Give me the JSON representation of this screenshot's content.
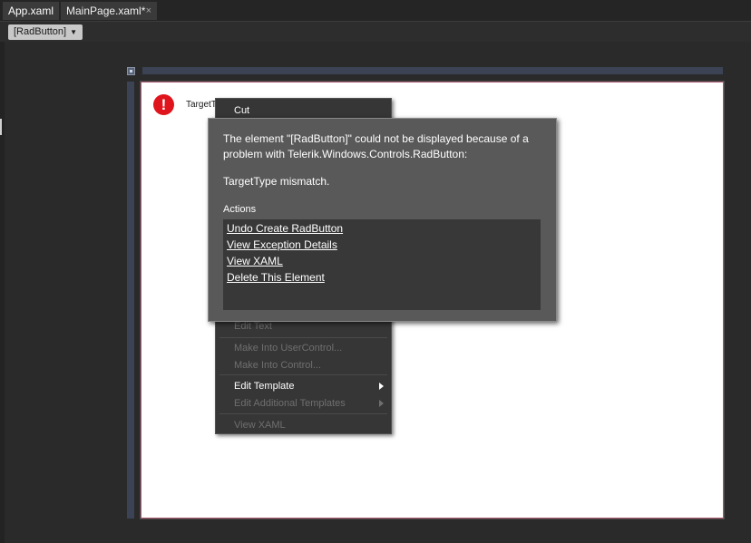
{
  "tabs": [
    {
      "label": "App.xaml"
    },
    {
      "label": "MainPage.xaml*",
      "close": "×"
    }
  ],
  "breadcrumb": {
    "label": "[RadButton]"
  },
  "canvas": {
    "target_text": "TargetT"
  },
  "context_menu": {
    "items": [
      {
        "label": "Cut",
        "enabled": true
      },
      {
        "label": "Edit Text",
        "enabled": false
      },
      {
        "label": "Make Into UserControl...",
        "enabled": false
      },
      {
        "label": "Make Into Control...",
        "enabled": false
      },
      {
        "label": "Edit Template",
        "enabled": true,
        "submenu": true
      },
      {
        "label": "Edit Additional Templates",
        "enabled": false,
        "submenu": true
      },
      {
        "label": "View XAML",
        "enabled": false
      }
    ]
  },
  "error_popup": {
    "message": "The element \"[RadButton]\" could not be displayed because of a problem with Telerik.Windows.Controls.RadButton:",
    "detail": "TargetType mismatch.",
    "actions_label": "Actions",
    "actions": [
      {
        "label": "Undo Create RadButton"
      },
      {
        "label": "View Exception Details"
      },
      {
        "label": "View XAML"
      },
      {
        "label": "Delete This Element"
      }
    ]
  },
  "colors": {
    "background": "#2a2a2a",
    "popup": "#595959",
    "actions_box": "#383838",
    "menu": "#363636",
    "error": "#e0141c",
    "ruler": "#3b4355"
  }
}
